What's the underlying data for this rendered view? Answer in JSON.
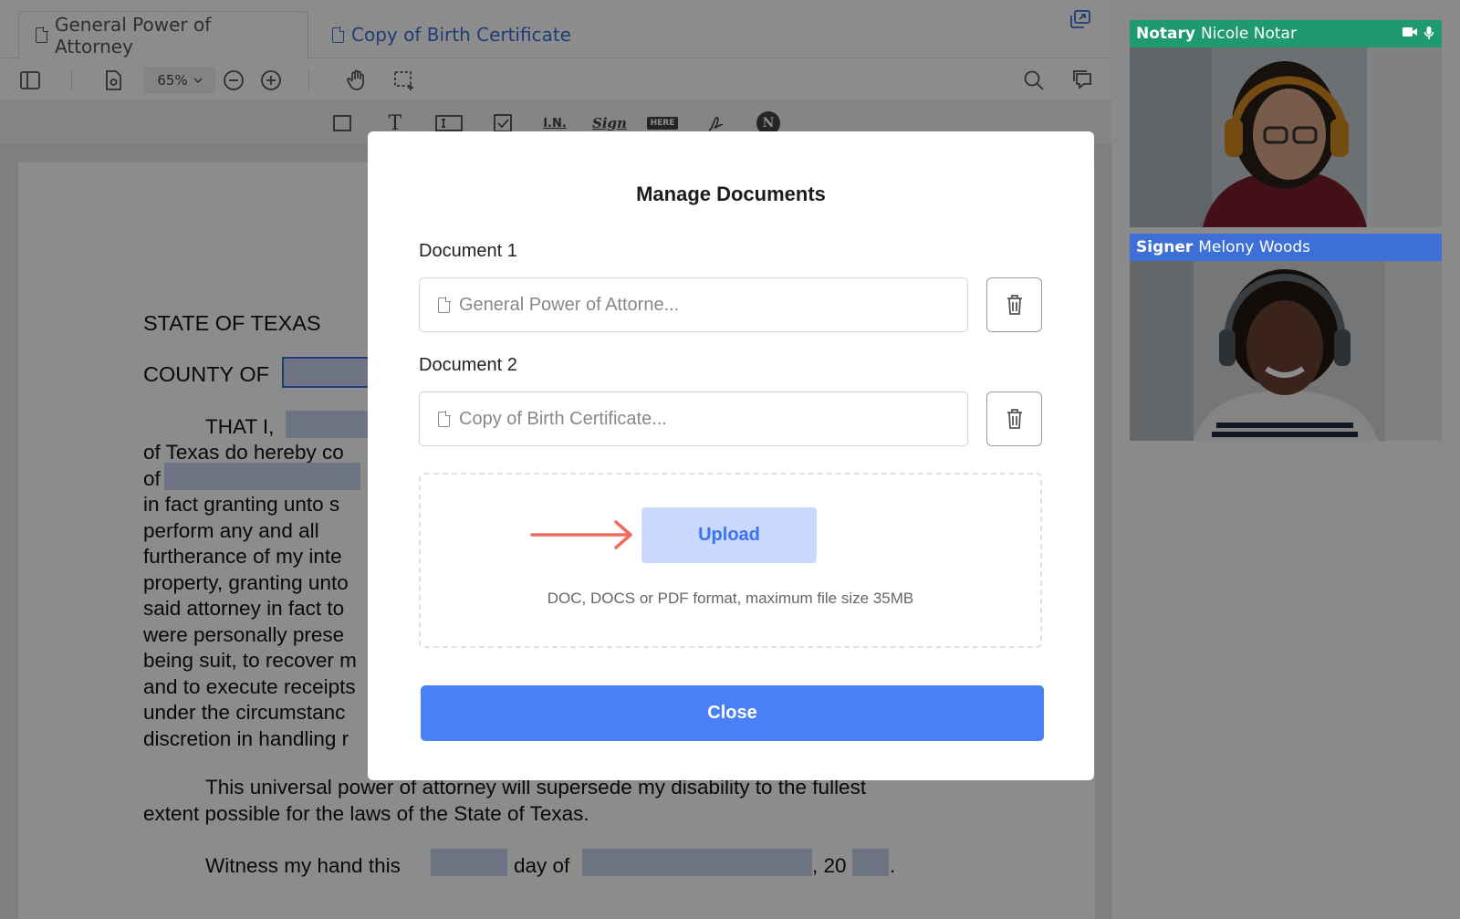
{
  "tabs": [
    {
      "label": "General Power of Attorney"
    },
    {
      "label": "Copy of Birth Certificate"
    }
  ],
  "toolbar": {
    "zoom": "65%"
  },
  "fieldbar": {
    "initials": "I.N.",
    "sign": "Sign",
    "here": "HERE",
    "notary": "N"
  },
  "document": {
    "state_line": "STATE OF TEXAS",
    "county_line": "COUNTY OF",
    "lines": [
      "THAT I,",
      "of Texas do hereby co",
      "of",
      "in fact granting unto s",
      "perform  any  and  all",
      "furtherance of my inte",
      "property, granting unto",
      "said attorney in fact to",
      "were personally prese",
      "being suit, to recover m",
      "and to execute receipts",
      "under  the  circumstanc",
      "discretion in handling r"
    ],
    "closing_1": "This universal power of attorney will supersede my disability to the fullest",
    "closing_2": "extent possible for the laws of the State of Texas.",
    "witness_a": "Witness my hand this",
    "witness_b": "day of",
    "witness_c": ", 20",
    "witness_d": "."
  },
  "participants": [
    {
      "role": "Notary",
      "name": "Nicole Notar",
      "color": "#1e9a6e"
    },
    {
      "role": "Signer",
      "name": "Melony Woods",
      "color": "#3e6fd6"
    }
  ],
  "modal": {
    "title": "Manage Documents",
    "doc1_label": "Document 1",
    "doc1_value": "General Power of Attorne...",
    "doc2_label": "Document 2",
    "doc2_value": "Copy of Birth Certificate...",
    "upload_label": "Upload",
    "upload_hint": "DOC, DOCS or PDF format, maximum file size 35MB",
    "close_label": "Close"
  }
}
